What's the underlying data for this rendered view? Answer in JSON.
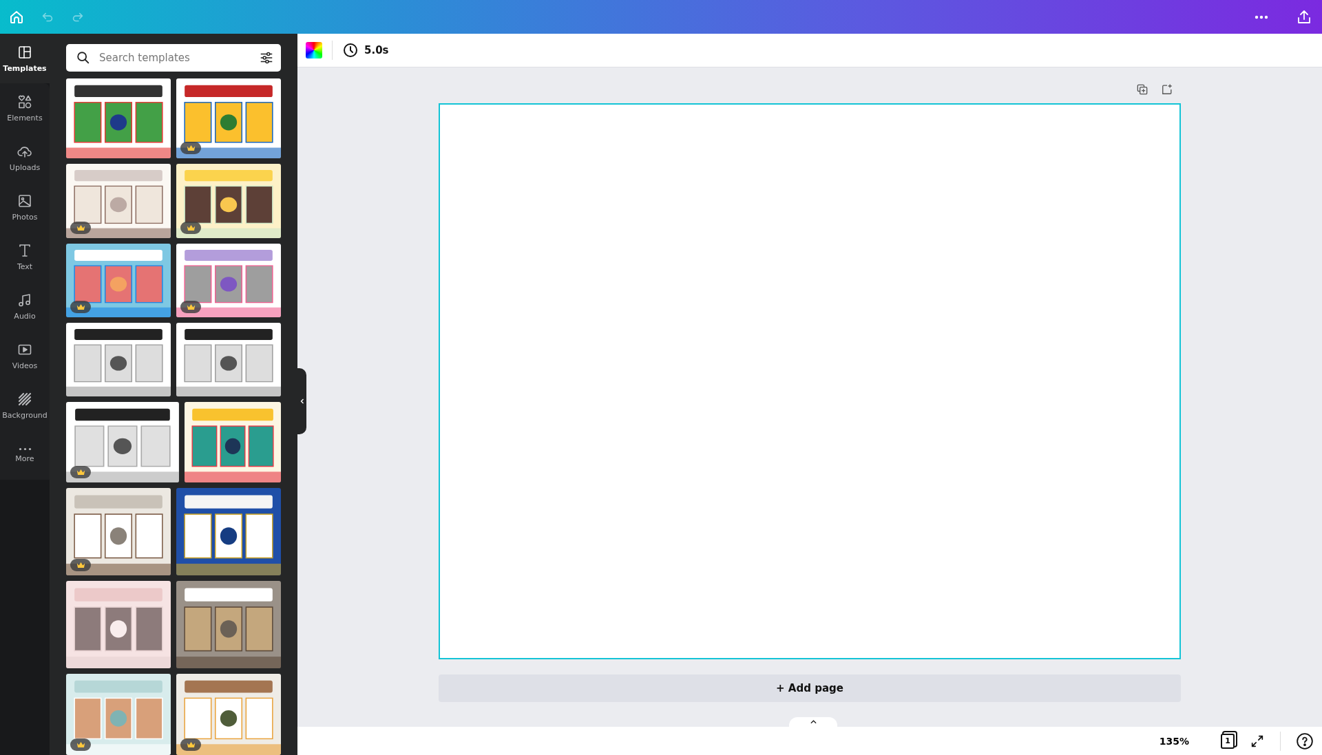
{
  "top_bar": {
    "undo_disabled": true,
    "redo_disabled": true
  },
  "rail": [
    {
      "label": "Templates",
      "selected": true
    },
    {
      "label": "Elements",
      "selected": false
    },
    {
      "label": "Uploads",
      "selected": false
    },
    {
      "label": "Photos",
      "selected": false
    },
    {
      "label": "Text",
      "selected": false
    },
    {
      "label": "Audio",
      "selected": false
    },
    {
      "label": "Videos",
      "selected": false
    },
    {
      "label": "Background",
      "selected": false
    },
    {
      "label": "More",
      "selected": false
    }
  ],
  "search": {
    "placeholder": "Search templates"
  },
  "templates": [
    {
      "kind": "picture",
      "premium": false
    },
    {
      "kind": "picture",
      "premium": true
    },
    {
      "kind": "picture",
      "premium": true
    },
    {
      "kind": "picture",
      "premium": true
    },
    {
      "kind": "picture",
      "premium": true
    },
    {
      "kind": "picture",
      "premium": true
    },
    {
      "kind": "picture",
      "premium": false
    },
    {
      "kind": "picture",
      "premium": false
    },
    {
      "kind": "picture",
      "premium": true
    },
    {
      "kind": "picture",
      "premium": false
    },
    {
      "kind": "picture",
      "premium": true
    },
    {
      "kind": "picture",
      "premium": false
    },
    {
      "kind": "picture",
      "premium": false
    },
    {
      "kind": "picture",
      "premium": false
    },
    {
      "kind": "picture",
      "premium": true
    },
    {
      "kind": "picture",
      "premium": true
    }
  ],
  "toolbar": {
    "duration": "5.0s"
  },
  "add_page": "+ Add page",
  "status_bar": {
    "zoom": "135%",
    "page_count": "1"
  }
}
